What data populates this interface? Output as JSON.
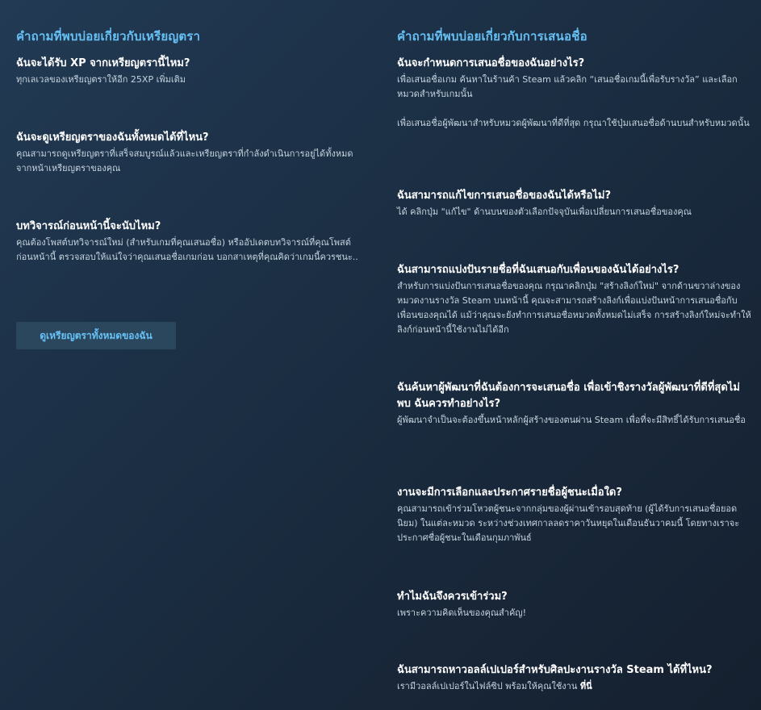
{
  "badges": {
    "title": "คำถามที่พบบ่อยเกี่ยวกับเหรียญตรา",
    "faqs": [
      {
        "q": "ฉันจะได้รับ XP จากเหรียญตรานี้ไหม?",
        "a": [
          "ทุกเลเวลของเหรียญตราให้อีก 25XP เพิ่มเติม"
        ]
      },
      {
        "q": "ฉันจะดูเหรียญตราของฉันทั้งหมดได้ที่ไหน?",
        "a": [
          "คุณสามารถดูเหรียญตราที่เสร็จสมบูรณ์แล้วและเหรียญตราที่กำลังดำเนินการอยู่ได้ทั้งหมดจากหน้าเหรียญตราของคุณ"
        ]
      },
      {
        "q": "บทวิจารณ์ก่อนหน้านี้จะนับไหม?",
        "a": [
          "คุณต้องโพสต์บทวิจารณ์ใหม่ (สำหรับเกมที่คุณเสนอชื่อ) หรืออัปเดตบทวิจารณ์ที่คุณโพสต์ก่อนหน้านี้ ตรวจสอบให้แน่ใจว่าคุณเสนอชื่อเกมก่อน บอกสาเหตุที่คุณคิดว่าเกมนี้ควรชนะ.."
        ]
      }
    ],
    "button_label": "ดูเหรียญตราทั้งหมดของฉัน"
  },
  "nominations": {
    "title": "คำถามที่พบบ่อยเกี่ยวกับการเสนอชื่อ",
    "faqs": [
      {
        "q": "ฉันจะกำหนดการเสนอชื่อของฉันอย่างไร?",
        "a": [
          "เพื่อเสนอชื่อเกม ค้นหาในร้านค้า Steam แล้วคลิก “เสนอชื่อเกมนี้เพื่อรับรางวัล” และเลือกหมวดสำหรับเกมนั้น",
          "เพื่อเสนอชื่อผู้พัฒนาสำหรับหมวดผู้พัฒนาที่ดีที่สุด กรุณาใช้ปุ่มเสนอชื่อด้านบนสำหรับหมวดนั้น"
        ]
      },
      {
        "q": "ฉันสามารถแก้ไขการเสนอชื่อของฉันได้หรือไม่?",
        "a": [
          "ได้ คลิกปุ่ม \"แก้ไข\" ด้านบนของตัวเลือกปัจจุบันเพื่อเปลี่ยนการเสนอชื่อของคุณ"
        ]
      },
      {
        "q": "ฉันสามารถแบ่งปันรายชื่อที่ฉันเสนอกับเพื่อนของฉันได้อย่างไร?",
        "a": [
          "สำหรับการแบ่งปันการเสนอชื่อของคุณ กรุณาคลิกปุ่ม \"สร้างลิงก์ใหม่\" จากด้านขวาล่างของหมวดงานรางวัล Steam บนหน้านี้ คุณจะสามารถสร้างลิงก์เพื่อแบ่งปันหน้าการเสนอชื่อกับเพื่อนของคุณได้ แม้ว่าคุณจะยังทำการเสนอชื่อหมวดทั้งหมดไม่เสร็จ การสร้างลิงก์ใหม่จะทำให้ลิงก์ก่อนหน้านี้ใช้งานไม่ได้อีก"
        ]
      },
      {
        "q": "ฉันค้นหาผู้พัฒนาที่ฉันต้องการจะเสนอชื่อ เพื่อเข้าชิงรางวัลผู้พัฒนาที่ดีที่สุดไม่พบ ฉันควรทำอย่างไร?",
        "a": [
          "ผู้พัฒนาจำเป็นจะต้องขึ้นหน้าหลักผู้สร้างของตนผ่าน Steam เพื่อที่จะมีสิทธิ์ได้รับการเสนอชื่อ"
        ]
      },
      {
        "q": "งานจะมีการเลือกและประกาศรายชื่อผู้ชนะเมื่อใด?",
        "a": [
          "คุณสามารถเข้าร่วมโหวตผู้ชนะจากกลุ่มของผู้ผ่านเข้ารอบสุดท้าย (ผู้ได้รับการเสนอชื่อยอดนิยม) ในแต่ละหมวด ระหว่างช่วงเทศกาลลดราคาวันหยุดในเดือนธันวาคมนี้ โดยทางเราจะประกาศชื่อผู้ชนะในเดือนกุมภาพันธ์"
        ]
      },
      {
        "q": "ทำไมฉันจึงควรเข้าร่วม?",
        "a": [
          "เพราะความคิดเห็นของคุณสำคัญ!"
        ]
      },
      {
        "q": "ฉันสามารถหาวอลล์เปเปอร์สำหรับศิลปะงานรางวัล Steam ได้ที่ไหน?",
        "a": [
          "เรามีวอลล์เปเปอร์ในไฟล์ซิป พร้อมให้คุณใช้งาน"
        ],
        "link": "ที่นี่"
      }
    ]
  }
}
